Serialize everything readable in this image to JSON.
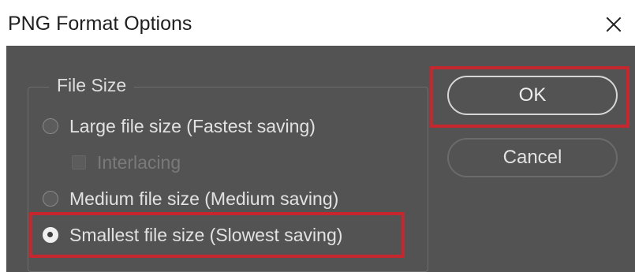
{
  "dialog": {
    "title": "PNG Format Options",
    "close_icon": "close-icon"
  },
  "file_size": {
    "legend": "File Size",
    "options": [
      {
        "label": "Large file size (Fastest saving)",
        "selected": false
      },
      {
        "label": "Medium file size (Medium saving)",
        "selected": false
      },
      {
        "label": "Smallest file size (Slowest saving)",
        "selected": true
      }
    ],
    "interlacing": {
      "label": "Interlacing",
      "checked": false,
      "disabled": true
    }
  },
  "buttons": {
    "ok": "OK",
    "cancel": "Cancel"
  },
  "colors": {
    "dialog_background": "#535353",
    "highlight": "#c6262e"
  }
}
